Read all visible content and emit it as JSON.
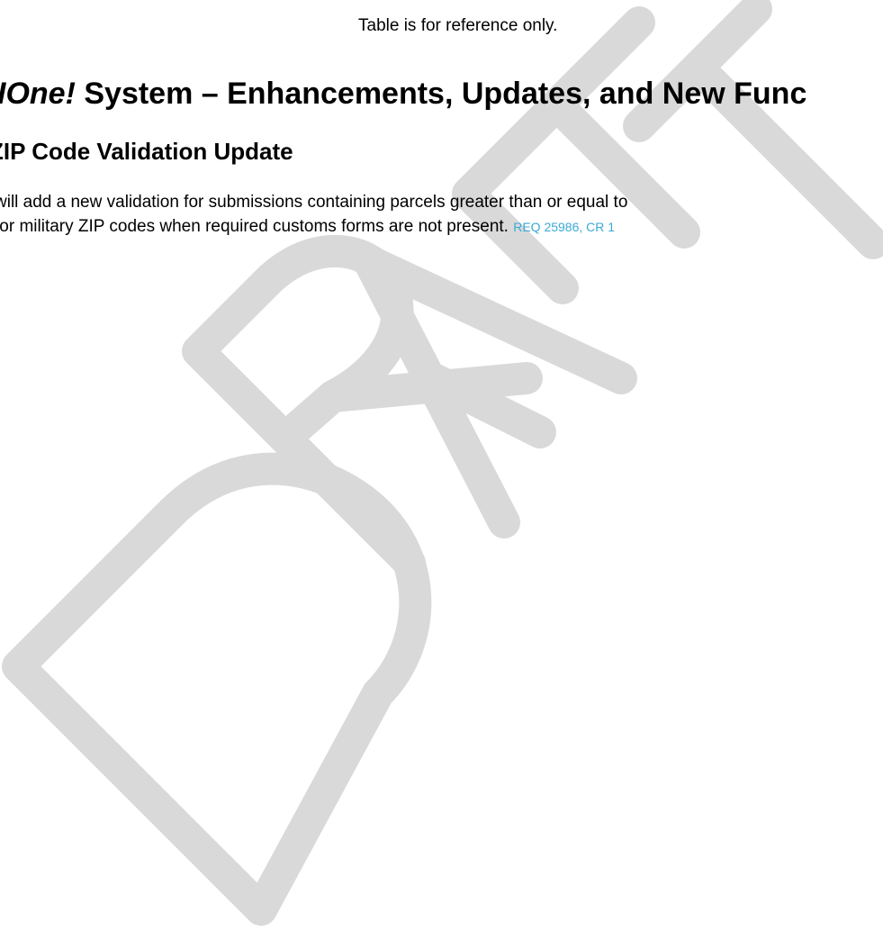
{
  "watermark": {
    "text": "DRAFT",
    "color": "#d9d9d9"
  },
  "doc": {
    "top_line": "Table is for reference only.",
    "heading1": {
      "italic_part": "IOne!",
      "rest": " System – Enhancements, Updates, and New Func"
    },
    "heading2": "ZIP Code Validation Update",
    "paragraph": {
      "line1": "will add a new validation for submissions containing parcels greater than or equal to",
      "line2": "for military ZIP codes when required customs forms are not present. ",
      "reference": "REQ 25986, CR 1"
    }
  },
  "colors": {
    "reference_link": "#3aa9d6",
    "text": "#000000"
  }
}
